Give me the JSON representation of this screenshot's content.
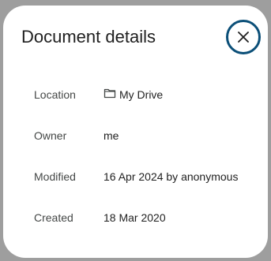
{
  "dialog": {
    "title": "Document details",
    "close_icon": "close-icon",
    "rows": [
      {
        "label": "Location",
        "value": "My Drive",
        "icon": "folder-icon"
      },
      {
        "label": "Owner",
        "value": "me"
      },
      {
        "label": "Modified",
        "value": "16 Apr 2024 by anonymous"
      },
      {
        "label": "Created",
        "value": "18 Mar 2020"
      }
    ]
  },
  "colors": {
    "backdrop": "#9e9e9e",
    "surface": "#ffffff",
    "focus_ring": "#0b4f78",
    "text_primary": "#1f1f1f",
    "text_secondary": "#444746"
  }
}
